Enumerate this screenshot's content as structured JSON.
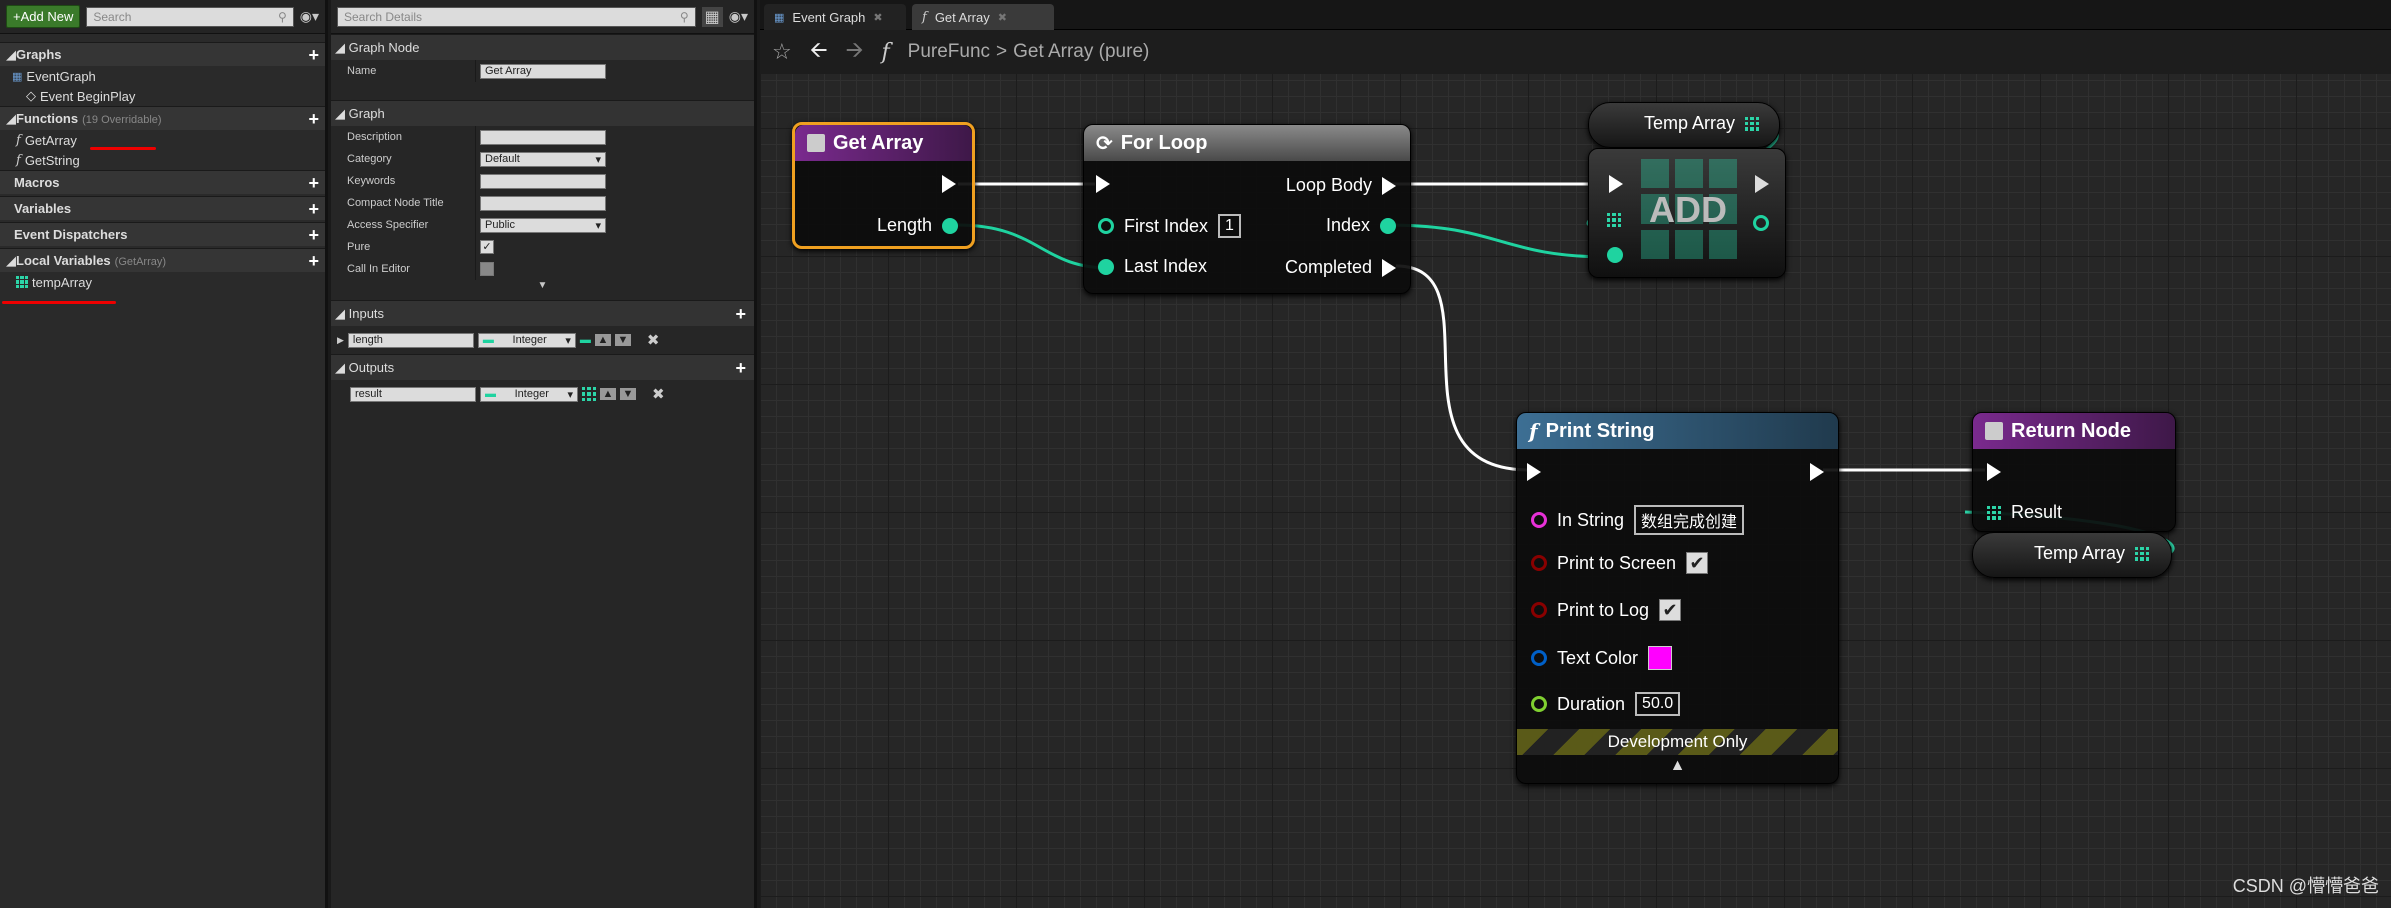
{
  "left_panel": {
    "add_new": "+Add New",
    "search_placeholder": "Search",
    "sections": {
      "graphs": "Graphs",
      "functions": "Functions",
      "functions_sub": "(19 Overridable)",
      "macros": "Macros",
      "variables": "Variables",
      "dispatchers": "Event Dispatchers",
      "locals": "Local Variables",
      "locals_sub": "(GetArray)"
    },
    "graph_items": [
      "EventGraph",
      "Event BeginPlay"
    ],
    "function_items": [
      "GetArray",
      "GetString"
    ],
    "local_items": [
      "tempArray"
    ]
  },
  "details": {
    "search_placeholder": "Search Details",
    "graph_node": "Graph Node",
    "name_label": "Name",
    "name_value": "Get Array",
    "graph": "Graph",
    "rows": [
      {
        "label": "Description",
        "value": ""
      },
      {
        "label": "Category",
        "value": "Default"
      },
      {
        "label": "Keywords",
        "value": ""
      },
      {
        "label": "Compact Node Title",
        "value": ""
      },
      {
        "label": "Access Specifier",
        "value": "Public"
      },
      {
        "label": "Pure",
        "value": "✓"
      },
      {
        "label": "Call In Editor",
        "value": ""
      }
    ],
    "inputs": "Inputs",
    "outputs": "Outputs",
    "input_param": {
      "name": "length",
      "type": "Integer"
    },
    "output_param": {
      "name": "result",
      "type": "Integer"
    }
  },
  "tabs": [
    "Event Graph",
    "Get Array"
  ],
  "breadcrumb": {
    "root": "PureFunc",
    "sep": ">",
    "current": "Get Array (pure)"
  },
  "nodes": {
    "get_array": {
      "title": "Get Array",
      "length": "Length"
    },
    "for_loop": {
      "title": "For Loop",
      "first_index": "First Index",
      "first_index_val": "1",
      "last_index": "Last Index",
      "loop_body": "Loop Body",
      "index": "Index",
      "completed": "Completed"
    },
    "temp_array_top": "Temp Array",
    "add": "ADD",
    "print_string": {
      "title": "Print String",
      "in_string": "In String",
      "in_string_val": "数组完成创建",
      "print_screen": "Print to Screen",
      "print_log": "Print to Log",
      "text_color": "Text Color",
      "duration": "Duration",
      "duration_val": "50.0",
      "dev_only": "Development Only"
    },
    "return_node": {
      "title": "Return Node",
      "result": "Result"
    },
    "temp_array_bottom": "Temp Array"
  },
  "watermark": "CSDN @懵懵爸爸",
  "colors": {
    "exec": "#ffffff",
    "int": "#1fd3a0",
    "array": "#2cd5a8",
    "string": "#e830d8",
    "bool": "#8a0000",
    "color": "#0060c8",
    "float": "#80d030",
    "accent_select": "#f0a020",
    "text_color_swatch": "#ff00ff"
  }
}
